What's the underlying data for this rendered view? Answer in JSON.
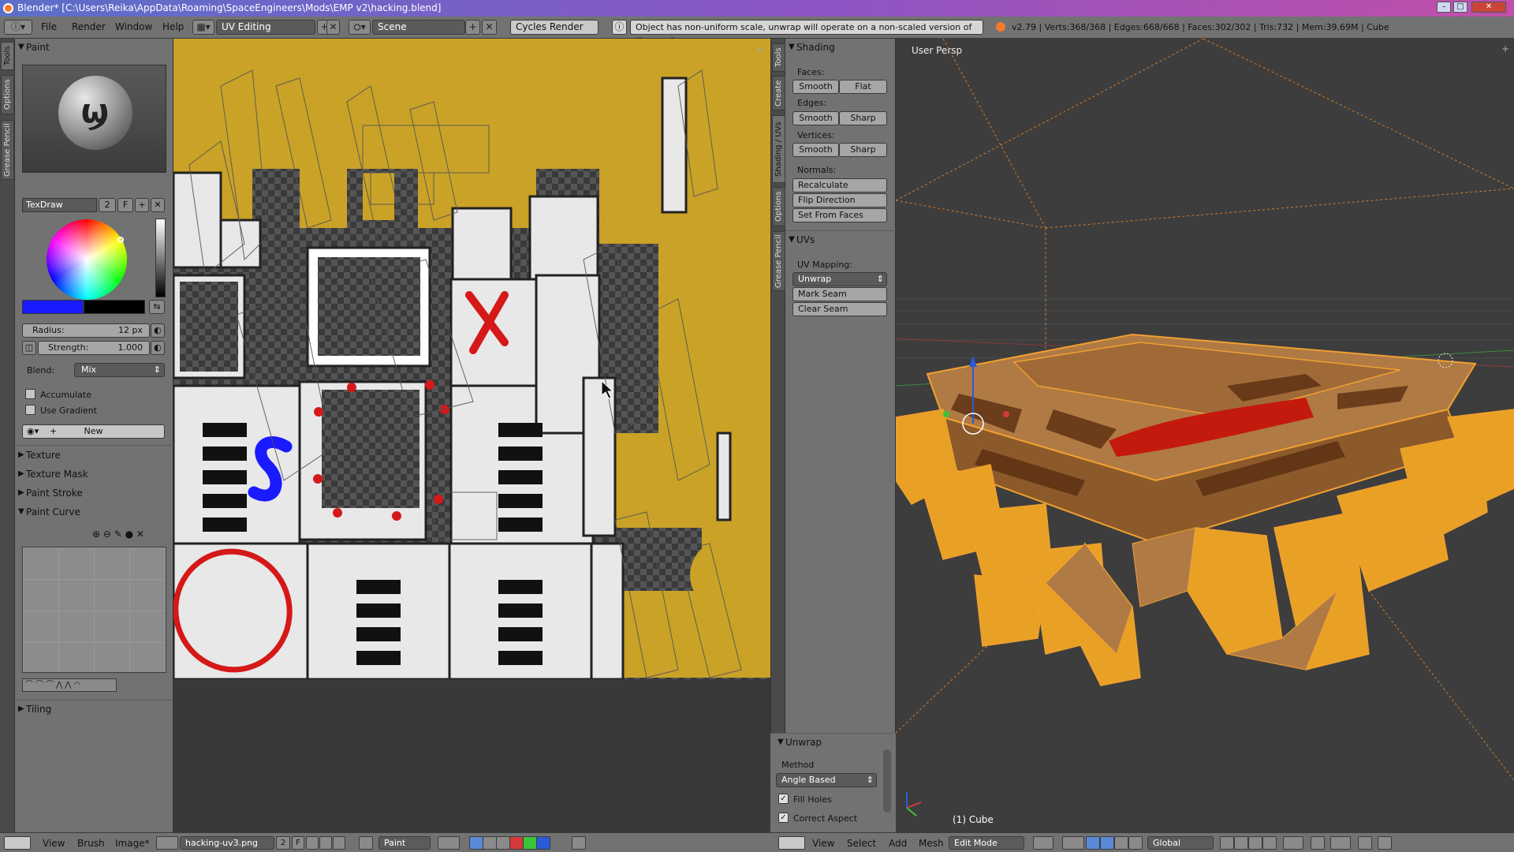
{
  "window": {
    "title": "Blender* [C:\\Users\\Reika\\AppData\\Roaming\\SpaceEngineers\\Mods\\EMP v2\\hacking.blend]"
  },
  "topbar": {
    "menus": [
      "File",
      "Render",
      "Window",
      "Help"
    ],
    "layout": "UV Editing",
    "scene": "Scene",
    "engine": "Cycles Render",
    "info_message": "Object has non-uniform scale, unwrap will operate on a non-scaled version of the mesh",
    "stats": "v2.79 | Verts:368/368 | Edges:668/668 | Faces:302/302 | Tris:732 | Mem:39.69M | Cube"
  },
  "left_tabs": [
    "Tools",
    "Options",
    "Grease Pencil"
  ],
  "paint_panel": {
    "header": "Paint",
    "brush_name": "TexDraw",
    "brush_users": "2",
    "brush_fake": "F",
    "radius_label": "Radius:",
    "radius_value": "12 px",
    "strength_label": "Strength:",
    "strength_value": "1.000",
    "blend_label": "Blend:",
    "blend_value": "Mix",
    "accumulate": "Accumulate",
    "use_gradient": "Use Gradient",
    "new_button": "New",
    "sections": [
      "Texture",
      "Texture Mask",
      "Paint Stroke",
      "Paint Curve"
    ],
    "tiling": "Tiling",
    "color_primary": "#1a1aff",
    "color_secondary": "#000000"
  },
  "prop_tabs": [
    "Tools",
    "Create",
    "Shading / UVs",
    "Options",
    "Grease Pencil"
  ],
  "shading_panel": {
    "header": "Shading",
    "faces_label": "Faces:",
    "edges_label": "Edges:",
    "vertices_label": "Vertices:",
    "smooth": "Smooth",
    "flat": "Flat",
    "sharp": "Sharp",
    "normals_label": "Normals:",
    "recalculate": "Recalculate",
    "flip_direction": "Flip Direction",
    "set_from_faces": "Set From Faces"
  },
  "uvs_panel": {
    "header": "UVs",
    "mapping_label": "UV Mapping:",
    "unwrap": "Unwrap",
    "mark_seam": "Mark Seam",
    "clear_seam": "Clear Seam"
  },
  "unwrap_panel": {
    "header": "Unwrap",
    "method_label": "Method",
    "method_value": "Angle Based",
    "fill_holes": "Fill Holes",
    "correct_aspect": "Correct Aspect"
  },
  "viewport": {
    "view_label": "User Persp",
    "object_label": "(1) Cube"
  },
  "bottom_left": {
    "menus": [
      "View",
      "Brush",
      "Image*"
    ],
    "image_name": "hacking-uv3.png",
    "image_users": "2",
    "image_fake": "F",
    "mode": "Paint"
  },
  "bottom_right": {
    "menus": [
      "View",
      "Select",
      "Add",
      "Mesh"
    ],
    "mode": "Edit Mode",
    "orientation": "Global"
  }
}
